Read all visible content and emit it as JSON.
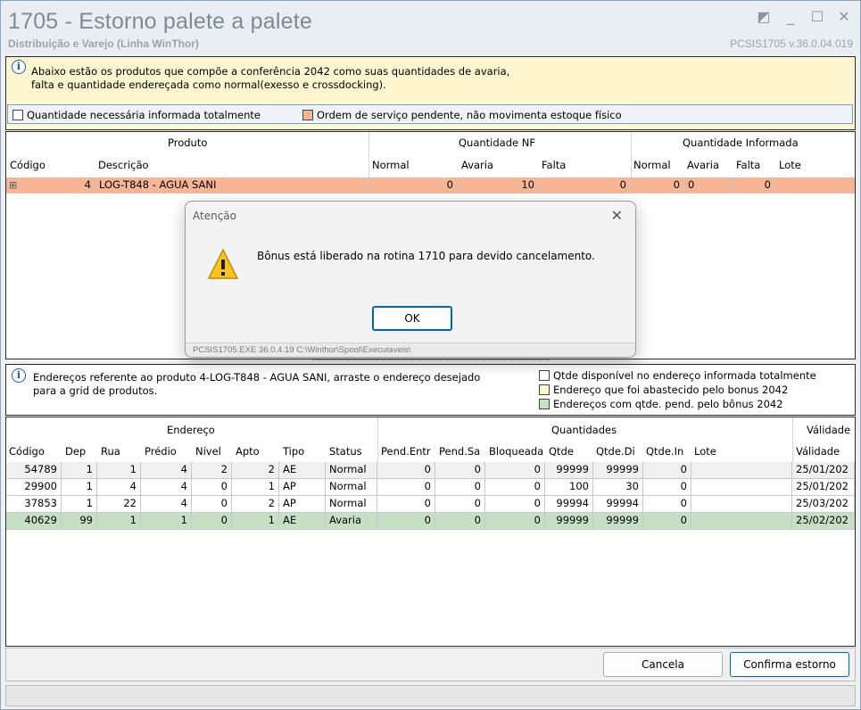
{
  "window": {
    "title": "1705 - Estorno palete a palete",
    "subtitle": "Distribuição e Varejo (Linha WinThor)",
    "version": "PCSIS1705  v.36.0.04.019"
  },
  "info": {
    "line1": "Abaixo estão os produtos que compõe a conferência 2042 como suas quantidades de avaria,",
    "line2": "falta e quantidade endereçada como normal(exesso e crossdocking)."
  },
  "legend": [
    {
      "label": "Quantidade necessária informada totalmente",
      "color": "#ffffff"
    },
    {
      "label": "Ordem de serviço pendente, não movimenta estoque físico",
      "color": "#f7b595"
    }
  ],
  "products_grid": {
    "groups": [
      "Produto",
      "Quantidade NF",
      "Quantidade Informada"
    ],
    "columns": [
      "Código",
      "Descrição",
      "Normal",
      "Avaria",
      "Falta",
      "Normal",
      "Avaria",
      "Falta",
      "Lote"
    ],
    "rows": [
      {
        "expand": "⊞",
        "codigo": "4",
        "descricao": "LOG-T848 - AGUA SANI",
        "nf_normal": "0",
        "nf_avaria": "10",
        "nf_falta": "0",
        "inf_normal": "0",
        "inf_avaria": "0",
        "inf_falta": "0",
        "lote": ""
      }
    ],
    "row_color": "#f7b595"
  },
  "dialog": {
    "title": "Atenção",
    "message": "Bônus está liberado na rotina 1710 para devido cancelamento.",
    "ok_label": "OK",
    "footer": "PCSIS1705.EXE 36.0.4.19 C:\\Winthor\\Spool\\Executaveis\\"
  },
  "address_info": {
    "line1": "Endereços referente ao produto 4-LOG-T848 - AGUA SANI, arraste o endereço desejado",
    "line2": "para a grid de produtos.",
    "legend": [
      {
        "label": "Qtde disponível no endereço informada totalmente",
        "color": "#ffffff"
      },
      {
        "label": "Endereço que foi abastecido pelo bonus 2042",
        "color": "#fdf6cf"
      },
      {
        "label": "Endereços com qtde. pend. pelo bônus 2042",
        "color": "#c6e0c6"
      }
    ]
  },
  "address_grid": {
    "groups": [
      "Endereço",
      "Quantidades",
      "Válidade"
    ],
    "columns": [
      "Código",
      "Dep",
      "Rua",
      "Prédio",
      "Nível",
      "Apto",
      "Tipo",
      "Status",
      "Pend.Entr",
      "Pend.Sa",
      "Bloqueada",
      "Qtde",
      "Qtde.Di",
      "Qtde.In",
      "Lote",
      "Válidade"
    ],
    "rows": [
      {
        "codigo": "54789",
        "dep": "1",
        "rua": "1",
        "predio": "4",
        "nivel": "2",
        "apto": "2",
        "tipo": "AE",
        "status": "Normal",
        "pend_entr": "0",
        "pend_sa": "0",
        "bloqueada": "0",
        "qtde": "99999",
        "qtde_di": "99999",
        "qtde_in": "0",
        "lote": "",
        "validade": "25/01/202",
        "bg": "#f0f0f0"
      },
      {
        "codigo": "29900",
        "dep": "1",
        "rua": "4",
        "predio": "4",
        "nivel": "0",
        "apto": "1",
        "tipo": "AP",
        "status": "Normal",
        "pend_entr": "0",
        "pend_sa": "0",
        "bloqueada": "0",
        "qtde": "100",
        "qtde_di": "30",
        "qtde_in": "0",
        "lote": "",
        "validade": "25/01/202",
        "bg": "#ffffff"
      },
      {
        "codigo": "37853",
        "dep": "1",
        "rua": "22",
        "predio": "4",
        "nivel": "0",
        "apto": "2",
        "tipo": "AP",
        "status": "Normal",
        "pend_entr": "0",
        "pend_sa": "0",
        "bloqueada": "0",
        "qtde": "99994",
        "qtde_di": "99994",
        "qtde_in": "0",
        "lote": "",
        "validade": "25/03/202",
        "bg": "#ffffff"
      },
      {
        "codigo": "40629",
        "dep": "99",
        "rua": "1",
        "predio": "1",
        "nivel": "0",
        "apto": "1",
        "tipo": "AE",
        "status": "Avaria",
        "pend_entr": "0",
        "pend_sa": "0",
        "bloqueada": "0",
        "qtde": "99999",
        "qtde_di": "99999",
        "qtde_in": "0",
        "lote": "",
        "validade": "25/02/202",
        "bg": "#c6e0c6"
      }
    ]
  },
  "buttons": {
    "cancel": "Cancela",
    "confirm": "Confirma estorno"
  }
}
